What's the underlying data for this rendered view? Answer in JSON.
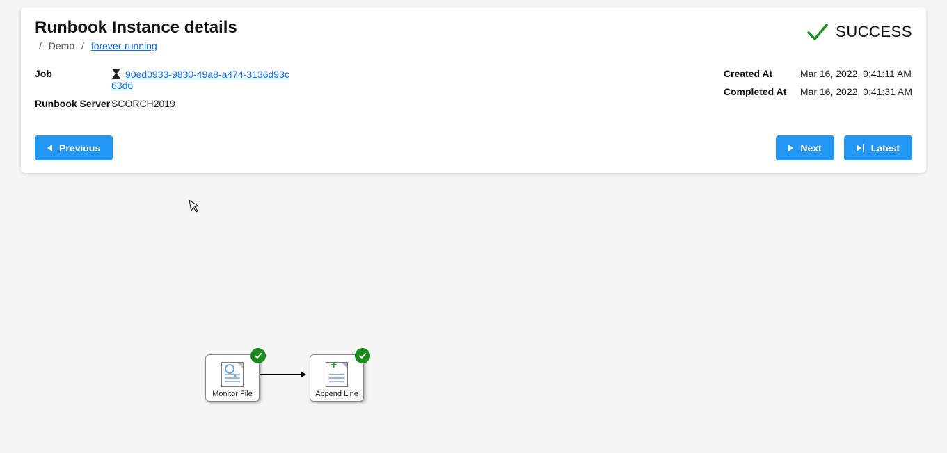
{
  "header": {
    "title": "Runbook Instance details",
    "status_label": "SUCCESS"
  },
  "breadcrumb": {
    "item0": "Demo",
    "item1": "forever-running"
  },
  "details_left": {
    "job_label": "Job",
    "job_link": "90ed0933-9830-49a8-a474-3136d93c63d6",
    "server_label": "Runbook Server",
    "server_value": "SCORCH2019"
  },
  "details_right": {
    "created_label": "Created At",
    "created_value": "Mar 16, 2022, 9:41:11 AM",
    "completed_label": "Completed At",
    "completed_value": "Mar 16, 2022, 9:41:31 AM"
  },
  "buttons": {
    "previous": "Previous",
    "next": "Next",
    "latest": "Latest"
  },
  "diagram": {
    "node0_label": "Monitor File",
    "node1_label": "Append Line"
  }
}
